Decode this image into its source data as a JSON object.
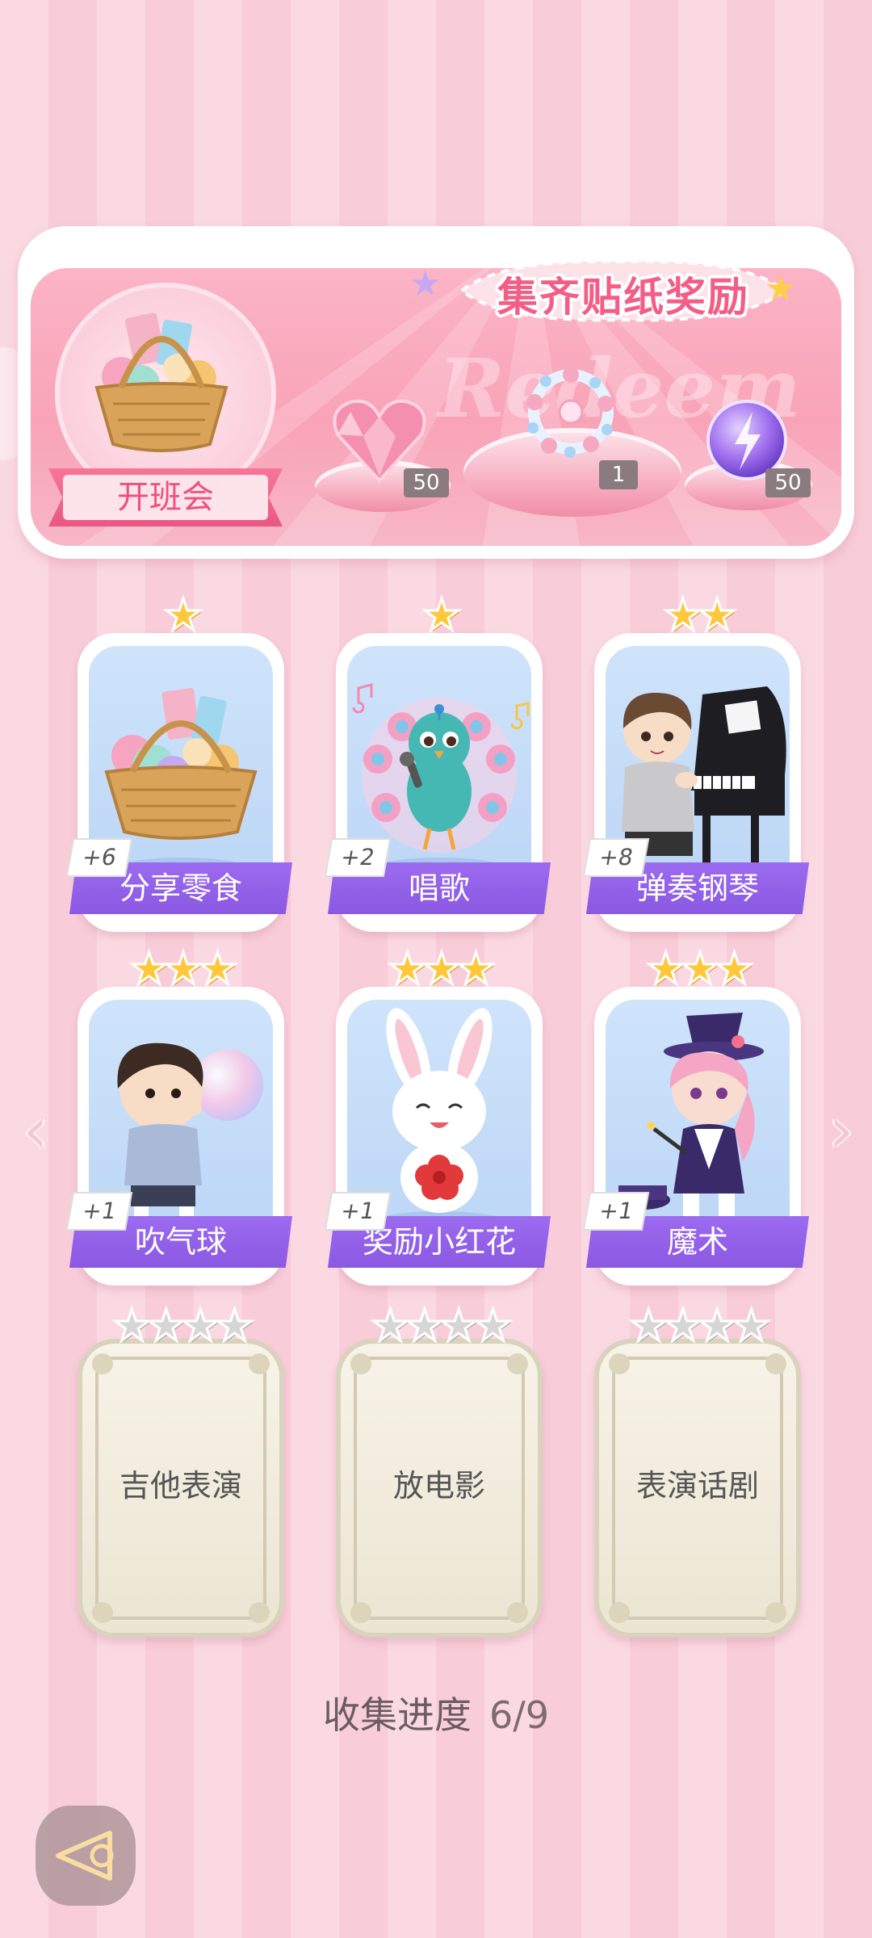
{
  "reward_panel": {
    "title": "集齐贴纸奖励",
    "watermark": "Redeem",
    "event_label": "开班会",
    "rewards": [
      {
        "icon": "pink-heart-gem-icon",
        "count": "50"
      },
      {
        "icon": "flower-bracelet-icon",
        "count": "1"
      },
      {
        "icon": "lightning-orb-icon",
        "count": "50"
      }
    ]
  },
  "stickers": [
    {
      "name": "分享零食",
      "bonus": "+6",
      "stars": 1,
      "max_stars": 1,
      "unlocked": true,
      "icon": "snack-basket-icon"
    },
    {
      "name": "唱歌",
      "bonus": "+2",
      "stars": 1,
      "max_stars": 1,
      "unlocked": true,
      "icon": "singing-peacock-icon"
    },
    {
      "name": "弹奏钢琴",
      "bonus": "+8",
      "stars": 2,
      "max_stars": 2,
      "unlocked": true,
      "icon": "piano-boy-icon"
    },
    {
      "name": "吹气球",
      "bonus": "+1",
      "stars": 3,
      "max_stars": 3,
      "unlocked": true,
      "icon": "balloon-boy-icon"
    },
    {
      "name": "奖励小红花",
      "bonus": "+1",
      "stars": 3,
      "max_stars": 3,
      "unlocked": true,
      "icon": "bunny-flower-icon"
    },
    {
      "name": "魔术",
      "bonus": "+1",
      "stars": 3,
      "max_stars": 3,
      "unlocked": true,
      "icon": "magician-girl-icon"
    },
    {
      "name": "吉他表演",
      "stars": 0,
      "max_stars": 4,
      "unlocked": false
    },
    {
      "name": "放电影",
      "stars": 0,
      "max_stars": 4,
      "unlocked": false
    },
    {
      "name": "表演话剧",
      "stars": 0,
      "max_stars": 4,
      "unlocked": false
    }
  ],
  "progress": {
    "label": "收集进度",
    "value": "6/9"
  },
  "nav": {
    "prev": "‹",
    "next": "›"
  },
  "colors": {
    "accent_pink": "#f35d86",
    "ribbon_purple": "#8a58e2",
    "star_gold": "#ffc83a",
    "locked_beige": "#ebe5d2"
  }
}
